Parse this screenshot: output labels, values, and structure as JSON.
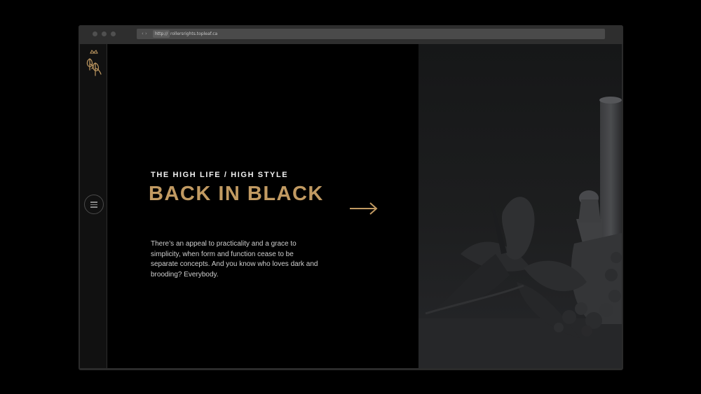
{
  "browser": {
    "nav_arrows": "‹ ›",
    "protocol": "http://",
    "host": "rollersrights.topleaf.ca"
  },
  "sidebar": {
    "logo_icon": "rr-crown-monogram-icon",
    "menu_icon": "hamburger-menu-icon"
  },
  "hero": {
    "eyebrow": "THE HIGH LIFE / HIGH STYLE",
    "headline": "BACK IN BLACK",
    "body": "There’s an appeal to practicality and a grace to simplicity, when form and function cease to be separate concepts. And you know who loves dark and brooding? Everybody.",
    "arrow_icon": "arrow-right-icon"
  },
  "colors": {
    "accent_gold": "#c19a62",
    "background": "#000000",
    "chrome": "#2e2e2e"
  }
}
